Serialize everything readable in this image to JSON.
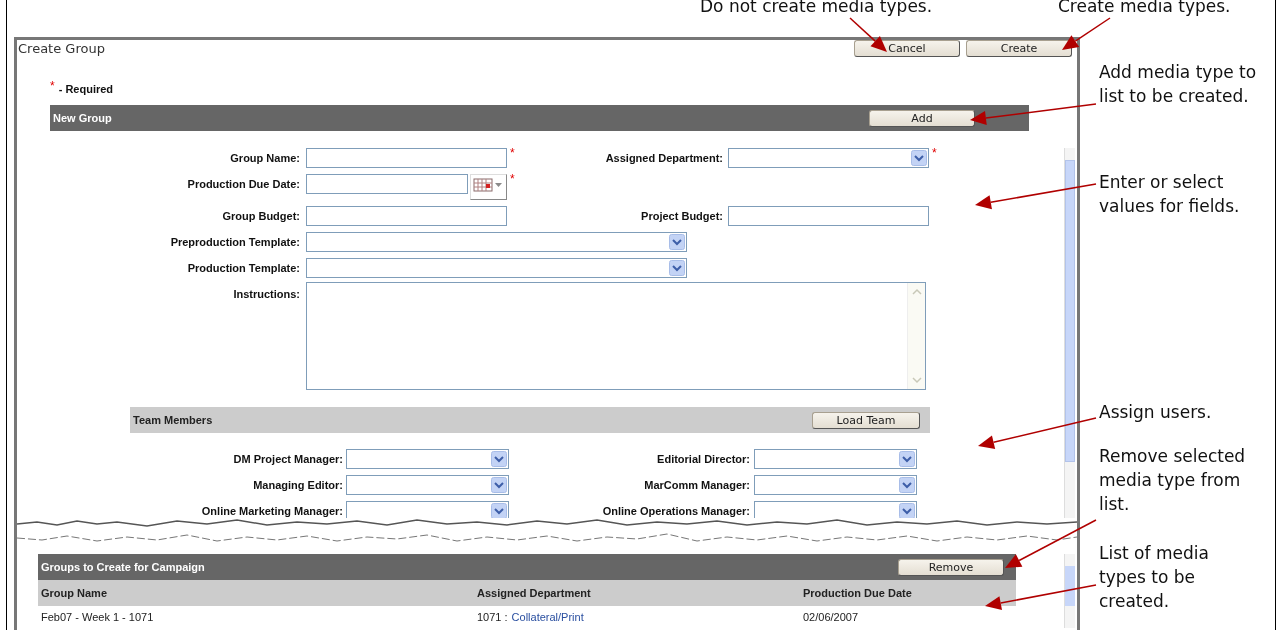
{
  "annotations": [
    {
      "text": "Do not create media types."
    },
    {
      "text": "Create media types."
    },
    {
      "text": "Add media type to list to be created."
    },
    {
      "text": "Enter or select values for fields."
    },
    {
      "text": "Assign users."
    },
    {
      "text": "Remove selected media type from list."
    },
    {
      "text": "List of media types to be created."
    }
  ],
  "window": {
    "title": "Create Group",
    "buttons": [
      "Cancel",
      "Create"
    ]
  },
  "required_note": {
    "mark": "*",
    "text": "- Required"
  },
  "new_group": {
    "title": "New Group",
    "button": "Add",
    "rows": [
      [
        {
          "label": "Group Name:",
          "kind": "text",
          "required": true
        },
        {
          "label": "Assigned Department:",
          "kind": "select",
          "required": true
        }
      ],
      [
        {
          "label": "Production Due Date:",
          "kind": "date",
          "required": true
        }
      ],
      [
        {
          "label": "Group Budget:",
          "kind": "text",
          "required": false
        },
        {
          "label": "Project Budget:",
          "kind": "text",
          "required": false
        }
      ],
      [
        {
          "label": "Preproduction Template:",
          "kind": "select",
          "required": false
        }
      ],
      [
        {
          "label": "Production Template:",
          "kind": "select",
          "required": false
        }
      ],
      [
        {
          "label": "Instructions:",
          "kind": "textarea",
          "required": false
        }
      ]
    ]
  },
  "team": {
    "title": "Team Members",
    "button": "Load Team",
    "rows": [
      [
        {
          "label": "DM Project Manager:",
          "kind": "select"
        },
        {
          "label": "Editorial Director:",
          "kind": "select"
        }
      ],
      [
        {
          "label": "Managing Editor:",
          "kind": "select"
        },
        {
          "label": "MarComm Manager:",
          "kind": "select"
        }
      ],
      [
        {
          "label": "Online Marketing Manager:",
          "kind": "select"
        },
        {
          "label": "Online Operations Manager:",
          "kind": "select"
        }
      ]
    ]
  },
  "groups_list": {
    "title": "Groups to Create for Campaign",
    "button": "Remove",
    "columns": [
      "Group Name",
      "Assigned Department",
      "Production Due Date"
    ],
    "rows": [
      {
        "group_name": "Feb07 - Week 1 - 1071",
        "department_code": "1071 :",
        "department_name": "Collateral/Print",
        "due_date": "02/06/2007"
      }
    ]
  }
}
